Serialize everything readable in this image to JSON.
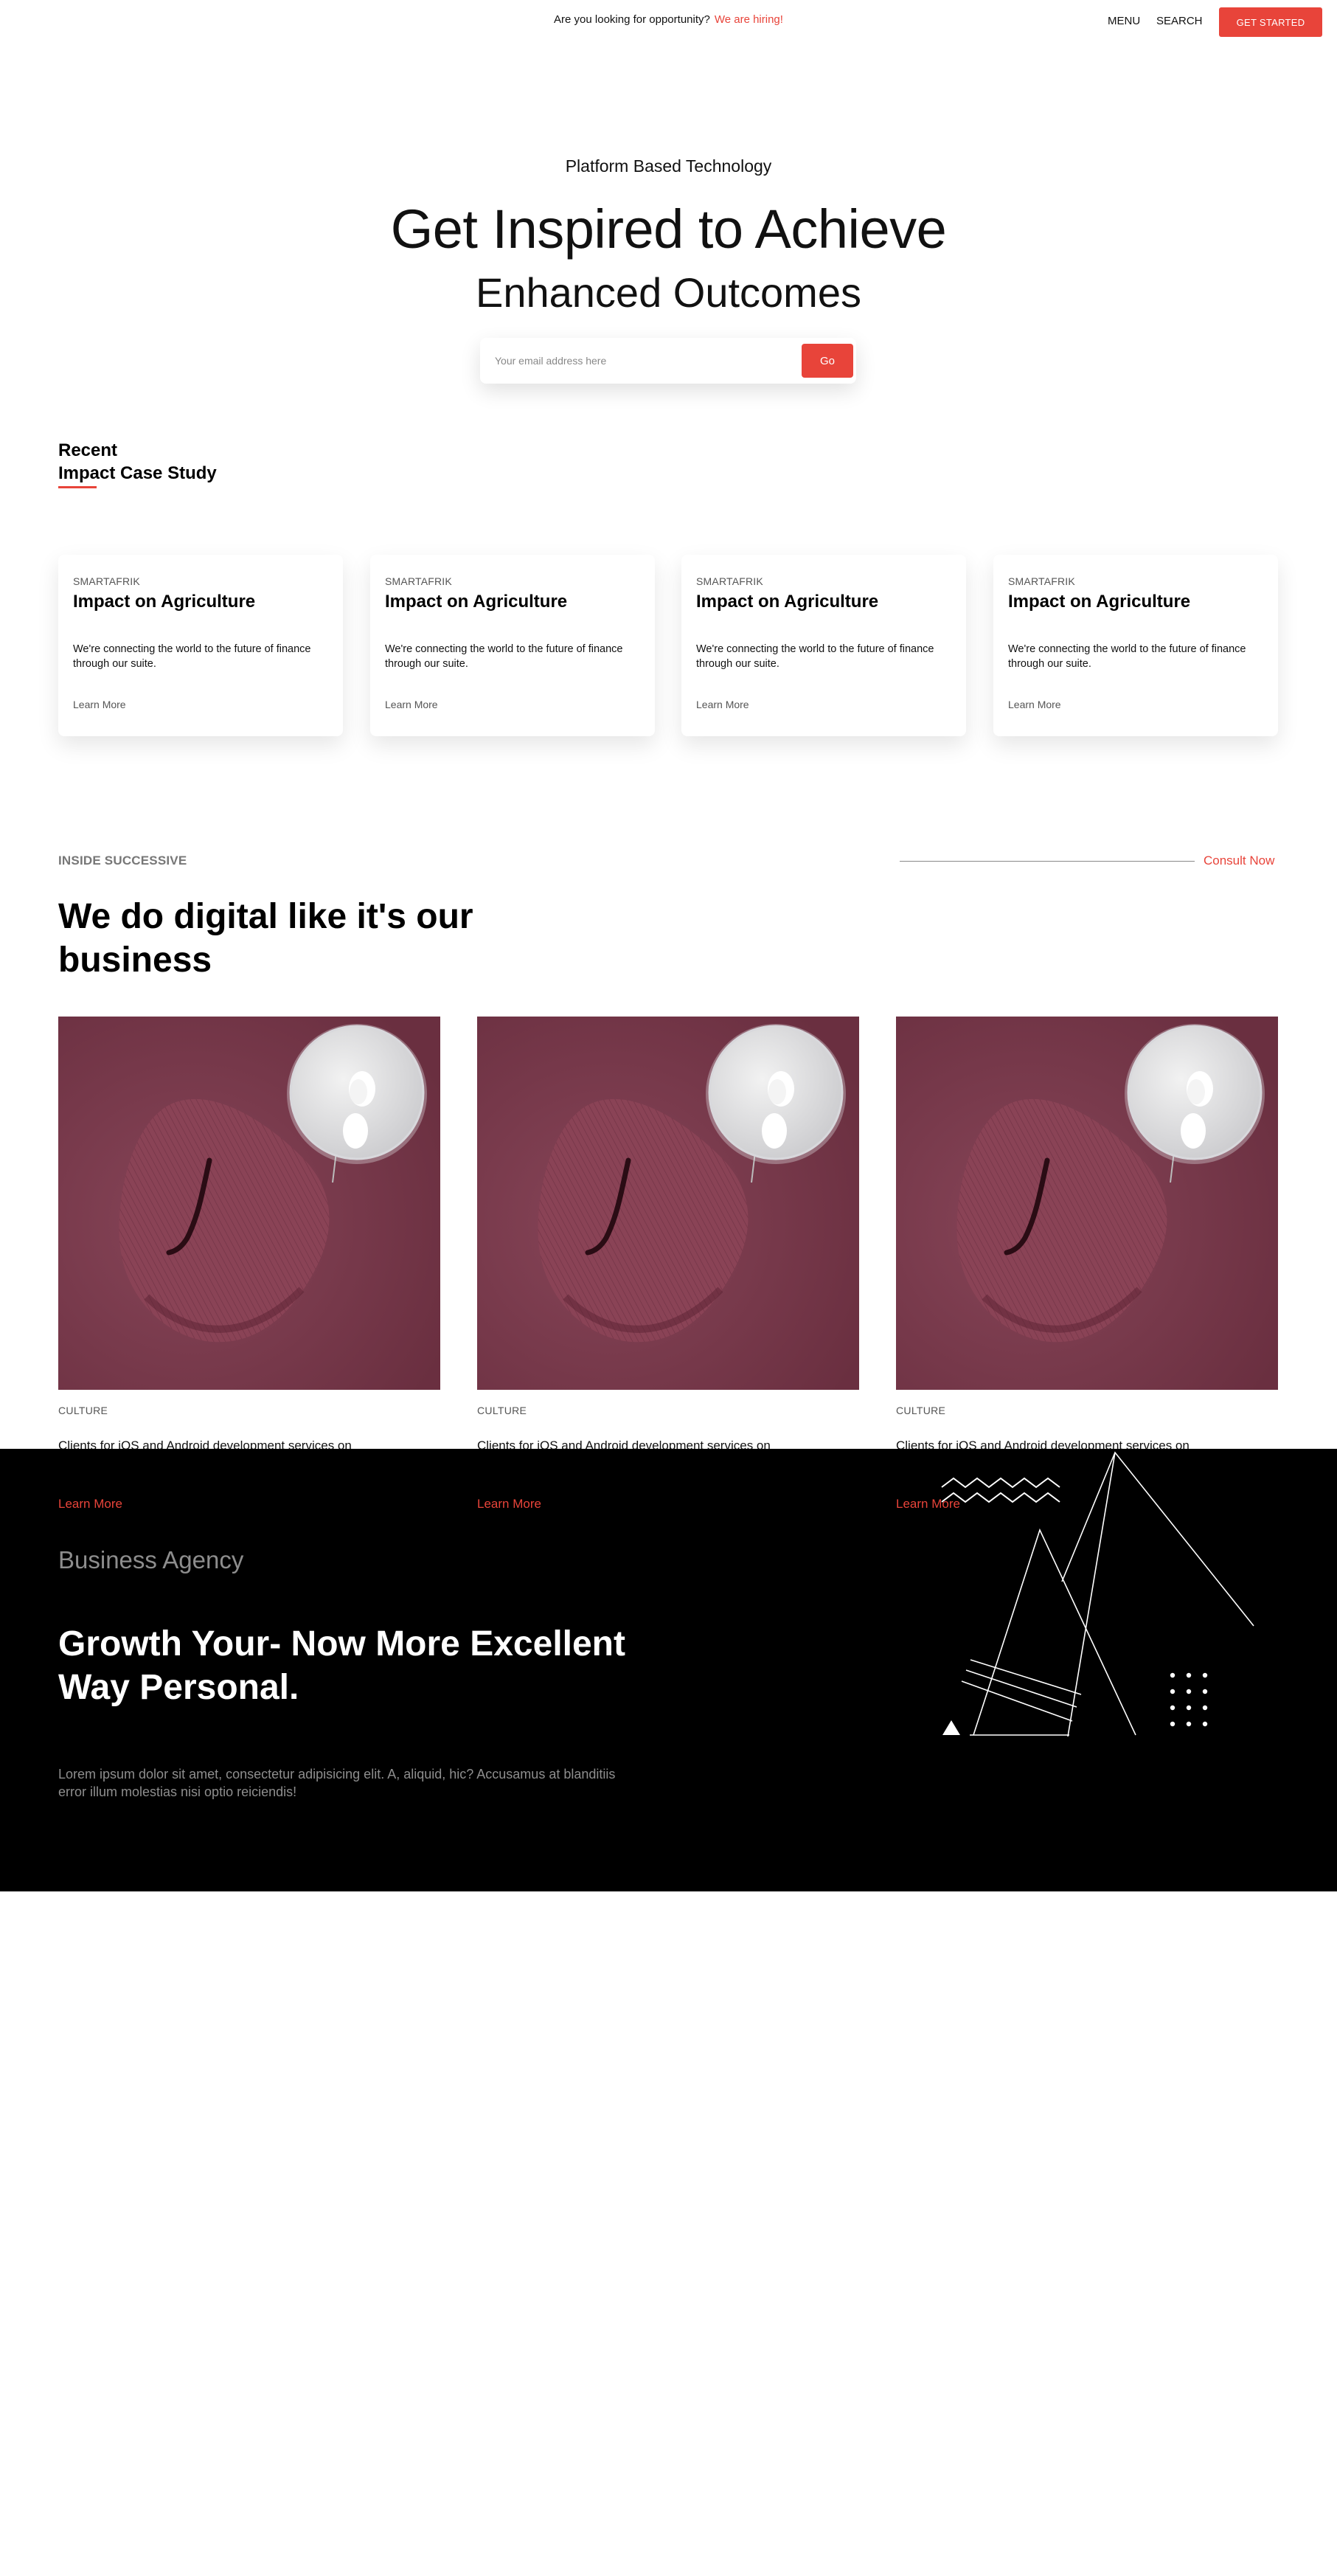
{
  "topbar": {
    "hiring_text": "Are you looking for opportunity?",
    "hiring_link": "We are hiring!",
    "menu": "MENU",
    "search": "SEARCH",
    "cta": "GET STARTED"
  },
  "hero": {
    "kicker": "Platform Based Technology",
    "line1": "Get Inspired to Achieve",
    "line2": "Enhanced Outcomes",
    "email_placeholder": "Your email address here",
    "go": "Go"
  },
  "recent": {
    "line1": "Recent",
    "line2": "Impact Case Study",
    "cards": [
      {
        "tag": "SMARTAFRIK",
        "title": "Impact on Agriculture",
        "desc": "We're connecting the world to the future of finance through our suite.",
        "more": "Learn More"
      },
      {
        "tag": "SMARTAFRIK",
        "title": "Impact on Agriculture",
        "desc": "We're connecting the world to the future of finance through our suite.",
        "more": "Learn More"
      },
      {
        "tag": "SMARTAFRIK",
        "title": "Impact on Agriculture",
        "desc": "We're connecting the world to the future of finance through our suite.",
        "more": "Learn More"
      },
      {
        "tag": "SMARTAFRIK",
        "title": "Impact on Agriculture",
        "desc": "We're connecting the world to the future of finance through our suite.",
        "more": "Learn More"
      }
    ]
  },
  "digital": {
    "kicker": "INSIDE SUCCESSIVE",
    "consult": "Consult Now",
    "heading": "We do digital like it's our business",
    "posts": [
      {
        "category": "CULTURE",
        "text": "Clients for iOS and Android development services on",
        "link": "Learn More"
      },
      {
        "category": "CULTURE",
        "text": "Clients for iOS and Android development services on",
        "link": "Learn More"
      },
      {
        "category": "CULTURE",
        "text": "Clients for iOS and Android development services on",
        "link": "Learn More"
      }
    ]
  },
  "agency": {
    "label": "Business Agency",
    "heading": "Growth Your- Now More Excellent Way Personal.",
    "body": "Lorem ipsum dolor sit amet, consectetur adipisicing elit. A, aliquid, hic? Accusamus at blanditiis error illum molestias nisi optio reiciendis!"
  },
  "colors": {
    "accent": "#e8443a",
    "dark_band": "#000000",
    "image_bg": "#7a3a4c"
  }
}
